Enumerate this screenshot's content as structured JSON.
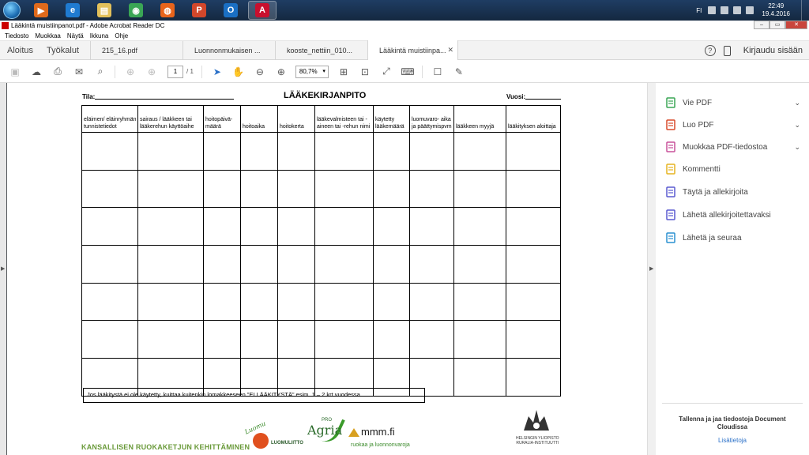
{
  "taskbar": {
    "apps": [
      {
        "name": "media-player",
        "color": "#e06a1b",
        "glyph": "▶"
      },
      {
        "name": "internet-explorer",
        "color": "#1f7bd1",
        "glyph": "e"
      },
      {
        "name": "file-explorer",
        "color": "#e3c15b",
        "glyph": "▤"
      },
      {
        "name": "chrome",
        "color": "#3aa655",
        "glyph": "◉"
      },
      {
        "name": "firefox",
        "color": "#e8641b",
        "glyph": "◍"
      },
      {
        "name": "powerpoint",
        "color": "#d2472b",
        "glyph": "P"
      },
      {
        "name": "outlook",
        "color": "#1a6fc4",
        "glyph": "O"
      },
      {
        "name": "acrobat",
        "color": "#c8102e",
        "glyph": "A"
      }
    ],
    "tray": {
      "language": "FI",
      "time": "22:49",
      "date": "19.4.2016"
    }
  },
  "window": {
    "title": "Lääkintä muistiinpanot.pdf - Adobe Acrobat Reader DC",
    "minimize": "–",
    "maximize": "▭",
    "close": "✕"
  },
  "menu": [
    "Tiedosto",
    "Muokkaa",
    "Näytä",
    "Ikkuna",
    "Ohje"
  ],
  "nav": {
    "home": "Aloitus",
    "tools": "Työkalut",
    "signin": "Kirjaudu sisään",
    "help": "?"
  },
  "tabs": [
    {
      "label": "215_16.pdf",
      "active": false
    },
    {
      "label": "Luonnonmukaisen ...",
      "active": false
    },
    {
      "label": "kooste_nettiin_010...",
      "active": false
    },
    {
      "label": "Lääkintä muistiinpa...",
      "active": true
    }
  ],
  "toolbar": {
    "page_current": "1",
    "page_total": "/ 1",
    "zoom": "80,7%"
  },
  "document": {
    "tila_label": "Tila:",
    "title": "LÄÄKEKIRJANPITO",
    "vuosi_label": "Vuosi:",
    "columns": [
      "eläimen/ eläinryhmän tunnistetiedot",
      "sairaus / lääkkeen tai lääkerehun käyttöaihe",
      "hoitopäivä- määrä",
      "hoitoaika",
      "hoitokerta",
      "lääkevalmisteen tai -aineen tai -rehun nimi",
      "käytetty lääkemäärä",
      "luomuvaro- aika ja päättymispvm",
      "lääkkeen myyjä",
      "lääkityksen aloittaja"
    ],
    "row_count": 7,
    "note": "Jos lääkitystä ei ole käytetty, kuittaa kuitenkin lomakkeeseen ”EI LÄÄKITYSTÄ” esim. 1 – 2 krt vuodessa",
    "footer": "KANSALLISEN RUOKAKETJUN KEHITTÄMINEN",
    "logos": {
      "luomu": "Luomu",
      "luomuliitto": "LUOMULIITTO",
      "agria_pro": "PRO",
      "agria": "Agria",
      "mmm": "mmm.fi",
      "mmm_sub": "ruokaa ja luonnonvaroja",
      "hy": "HELSINGIN YLIOPISTO",
      "hy_sub": "RURALIA-INSTITUUTTI"
    }
  },
  "right_panel": {
    "items": [
      {
        "label": "Vie PDF",
        "color": "#3aa655",
        "chevron": true
      },
      {
        "label": "Luo PDF",
        "color": "#d94a2a",
        "chevron": true
      },
      {
        "label": "Muokkaa PDF-tiedostoa",
        "color": "#c8509a",
        "chevron": true
      },
      {
        "label": "Kommentti",
        "color": "#e6b420",
        "chevron": false
      },
      {
        "label": "Täytä ja allekirjoita",
        "color": "#5a5ad0",
        "chevron": false
      },
      {
        "label": "Lähetä allekirjoitettavaksi",
        "color": "#5a5ad0",
        "chevron": false
      },
      {
        "label": "Lähetä ja seuraa",
        "color": "#2a90d0",
        "chevron": false
      }
    ],
    "cloud_text": "Tallenna ja jaa tiedostoja Document Cloudissa",
    "more_link": "Lisätietoja"
  }
}
